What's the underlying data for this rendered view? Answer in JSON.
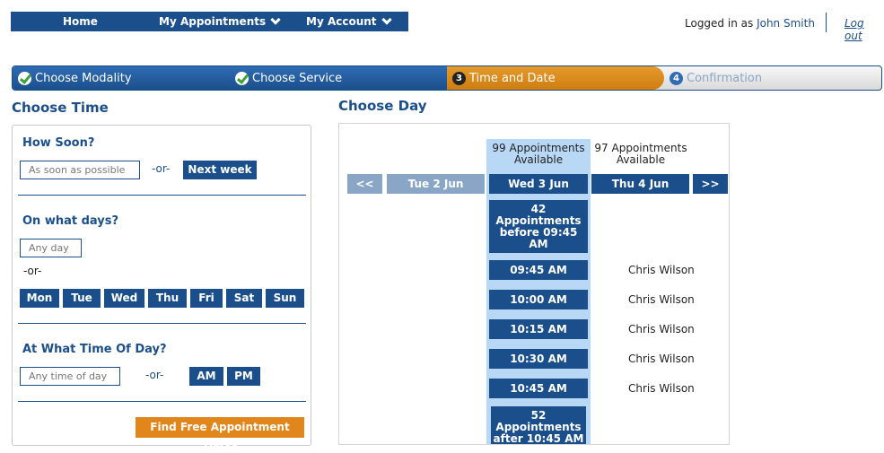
{
  "nav": {
    "home": "Home",
    "appointments": "My Appointments",
    "account": "My Account"
  },
  "login": {
    "prefix": "Logged in as",
    "user": "John Smith",
    "logout": "Log out"
  },
  "steps": [
    {
      "label": "Choose Modality",
      "state": "done"
    },
    {
      "label": "Choose Service",
      "state": "done"
    },
    {
      "label": "Time and Date",
      "state": "current",
      "num": "3"
    },
    {
      "label": "Confirmation",
      "state": "pending",
      "num": "4"
    }
  ],
  "choose_time": {
    "title": "Choose Time",
    "how_soon": {
      "title": "How Soon?",
      "field": "As soon as possible",
      "or": "-or-",
      "button": "Next week"
    },
    "days": {
      "title": "On what days?",
      "field": "Any day",
      "or": "-or-",
      "buttons": [
        "Mon",
        "Tue",
        "Wed",
        "Thu",
        "Fri",
        "Sat",
        "Sun"
      ]
    },
    "time_of_day": {
      "title": "At What Time Of Day?",
      "field": "Any time of day",
      "or": "-or-",
      "am": "AM",
      "pm": "PM"
    },
    "find_button": "Find Free Appointment Times"
  },
  "choose_day": {
    "title": "Choose Day",
    "prev": "<<",
    "next": ">>",
    "days": [
      {
        "label": "Tue 2 Jun",
        "available": ""
      },
      {
        "label": "Wed 3 Jun",
        "available": "99 Appointments\nAvailable"
      },
      {
        "label": "Thu 4 Jun",
        "available": "97 Appointments\nAvailable"
      }
    ],
    "before_group": "42\nAppointments\nbefore 09:45\nAM",
    "slots": [
      {
        "time": "09:45 AM",
        "person": "Chris Wilson"
      },
      {
        "time": "10:00 AM",
        "person": "Chris Wilson"
      },
      {
        "time": "10:15 AM",
        "person": "Chris Wilson"
      },
      {
        "time": "10:30 AM",
        "person": "Chris Wilson"
      },
      {
        "time": "10:45 AM",
        "person": "Chris Wilson"
      }
    ],
    "after_group": "52\nAppointments\nafter 10:45 AM"
  }
}
